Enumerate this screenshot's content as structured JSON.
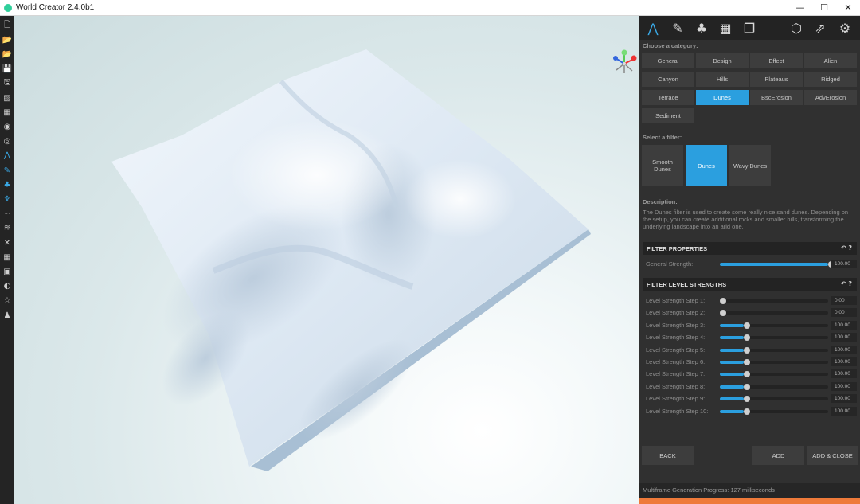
{
  "window": {
    "title": "World Creator 2.4.0b1",
    "min_glyph": "—",
    "max_glyph": "☐",
    "close_glyph": "✕"
  },
  "left_toolbar": {
    "tools": [
      {
        "name": "new-file-icon",
        "glyph": "🗋"
      },
      {
        "name": "open-file-icon",
        "glyph": "📂"
      },
      {
        "name": "open-recent-icon",
        "glyph": "📂"
      },
      {
        "name": "save-icon",
        "glyph": "💾"
      },
      {
        "name": "save-as-icon",
        "glyph": "🖫"
      },
      {
        "name": "export-icon",
        "glyph": "▧"
      },
      {
        "name": "map-icon",
        "glyph": "▦"
      },
      {
        "name": "camera-icon",
        "glyph": "◉"
      },
      {
        "name": "globe-icon",
        "glyph": "◎"
      },
      {
        "name": "terrain-icon",
        "glyph": "⋀",
        "active": true
      },
      {
        "name": "brush-icon",
        "glyph": "✎",
        "active": true
      },
      {
        "name": "tree-icon",
        "glyph": "♣",
        "active": true
      },
      {
        "name": "grass-icon",
        "glyph": "♆",
        "active": true
      },
      {
        "name": "road-icon",
        "glyph": "∽"
      },
      {
        "name": "wind-icon",
        "glyph": "≋"
      },
      {
        "name": "transform-icon",
        "glyph": "✕"
      },
      {
        "name": "grid-icon",
        "glyph": "▦"
      },
      {
        "name": "image-icon",
        "glyph": "▣"
      },
      {
        "name": "sky-icon",
        "glyph": "◐"
      },
      {
        "name": "star-icon",
        "glyph": "☆"
      },
      {
        "name": "figure-icon",
        "glyph": "♟"
      }
    ]
  },
  "panel": {
    "tabs": [
      {
        "name": "terrain-tab-icon",
        "glyph": "⋀",
        "active": true
      },
      {
        "name": "brush-tab-icon",
        "glyph": "✎"
      },
      {
        "name": "vegetation-tab-icon",
        "glyph": "♣"
      },
      {
        "name": "map-tab-icon",
        "glyph": "▦"
      },
      {
        "name": "layers-tab-icon",
        "glyph": "❐"
      },
      {
        "name": "cube-tab-icon",
        "glyph": "⬡"
      },
      {
        "name": "share-tab-icon",
        "glyph": "⇗"
      },
      {
        "name": "settings-tab-icon",
        "glyph": "⚙"
      }
    ],
    "category_label": "Choose a category:",
    "categories": [
      "General",
      "Design",
      "Effect",
      "Alien",
      "Canyon",
      "Hills",
      "Plateaus",
      "Ridged",
      "Terrace",
      "Dunes",
      "BscErosion",
      "AdvErosion",
      "Sediment"
    ],
    "selected_category": "Dunes",
    "filter_label": "Select a filter:",
    "filters": [
      "Smooth Dunes",
      "Dunes",
      "Wavy Dunes"
    ],
    "selected_filter": "Dunes",
    "description_label": "Description:",
    "description": "The Dunes filter is used to create some really nice sand dunes. Depending on the setup, you can create additional rocks and smaller hills, transforming the underlying landscape into an arid one.",
    "filter_properties": {
      "title": "FILTER PROPERTIES",
      "icons": "↶  ?",
      "sliders": [
        {
          "label": "General Strength:",
          "value": "100.00",
          "fraction": 1.0
        }
      ]
    },
    "level_strengths": {
      "title": "FILTER LEVEL STRENGTHS",
      "icons": "↶  ?",
      "sliders": [
        {
          "label": "Level Strength Step 1:",
          "value": "0.00",
          "fraction": 0.0
        },
        {
          "label": "Level Strength Step 2:",
          "value": "0.00",
          "fraction": 0.0
        },
        {
          "label": "Level Strength Step 3:",
          "value": "100.00",
          "fraction": 0.22
        },
        {
          "label": "Level Strength Step 4:",
          "value": "100.00",
          "fraction": 0.22
        },
        {
          "label": "Level Strength Step 5:",
          "value": "100.00",
          "fraction": 0.22
        },
        {
          "label": "Level Strength Step 6:",
          "value": "100.00",
          "fraction": 0.22
        },
        {
          "label": "Level Strength Step 7:",
          "value": "100.00",
          "fraction": 0.22
        },
        {
          "label": "Level Strength Step 8:",
          "value": "100.00",
          "fraction": 0.22
        },
        {
          "label": "Level Strength Step 9:",
          "value": "100.00",
          "fraction": 0.22
        },
        {
          "label": "Level Strength Step 10:",
          "value": "100.00",
          "fraction": 0.22
        }
      ]
    },
    "buttons": {
      "back": "BACK",
      "add": "ADD",
      "add_close": "ADD & CLOSE"
    },
    "status": "Multiframe Generation Progress: 127 milliseconds"
  },
  "colors": {
    "accent": "#2b9fdf",
    "progress": "#ee7a3a",
    "panel_bg": "#303030",
    "terrain": "#dde8f2"
  }
}
